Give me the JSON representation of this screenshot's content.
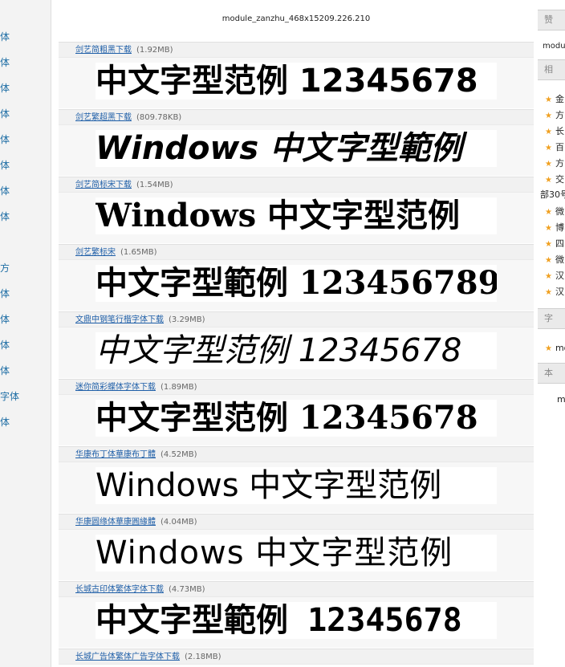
{
  "left_rail": {
    "items": [
      "体",
      "体",
      "体",
      "体",
      "体",
      "体",
      "体",
      "体",
      "方",
      "体",
      "体",
      "体",
      "体",
      "字体",
      "体"
    ]
  },
  "ad_banner": "module_zanzhu_468x15209.226.210",
  "fonts": [
    {
      "link": "剑艺简粗黑下载",
      "size": "(1.92MB)",
      "sample": "中文字型范例 12345678"
    },
    {
      "link": "剑艺繁超黑下载",
      "size": "(809.78KB)",
      "sample": "Windows 中文字型範例"
    },
    {
      "link": "剑艺简标宋下载",
      "size": "(1.54MB)",
      "sample": "Windows 中文字型范例"
    },
    {
      "link": "剑艺繁标宋",
      "size": "(1.65MB)",
      "sample": "中文字型範例 123456789"
    },
    {
      "link": "文鼎中钢笔行楷字体下载",
      "size": "(3.29MB)",
      "sample": "中文字型范例 12345678"
    },
    {
      "link": "迷你简彩蝶体字体下载",
      "size": "(1.89MB)",
      "sample": "中文字型范例 12345678"
    },
    {
      "link": "华康布丁体華康布丁體",
      "size": "(4.52MB)",
      "sample": "Windows 中文字型范例"
    },
    {
      "link": "华康圆缘体華康圓緣體",
      "size": "(4.04MB)",
      "sample": "Windows 中文字型范例"
    },
    {
      "link": "长城古印体繁体字体下载",
      "size": "(4.73MB)",
      "sample": "中文字型範例 12345678"
    },
    {
      "link": "长城广告体繁体广告字体下载",
      "size": "(2.18MB)",
      "sample": ""
    }
  ],
  "right_rail": {
    "heading_1": "赞",
    "text_1": "modu",
    "heading_2": "相",
    "list_a": [
      "金",
      "方",
      "长",
      "百",
      "方",
      "交"
    ],
    "text_2": "部30号",
    "list_b": [
      "微",
      "博",
      "四",
      "微",
      "汉",
      "汉"
    ],
    "heading_3": "字",
    "list_c": [
      "mo"
    ],
    "heading_4": "本",
    "text_3": "mo"
  },
  "colors": {
    "link": "#1f5fa8",
    "accent_star": "#f0a020",
    "left_rail_text": "#1f6ea5"
  }
}
